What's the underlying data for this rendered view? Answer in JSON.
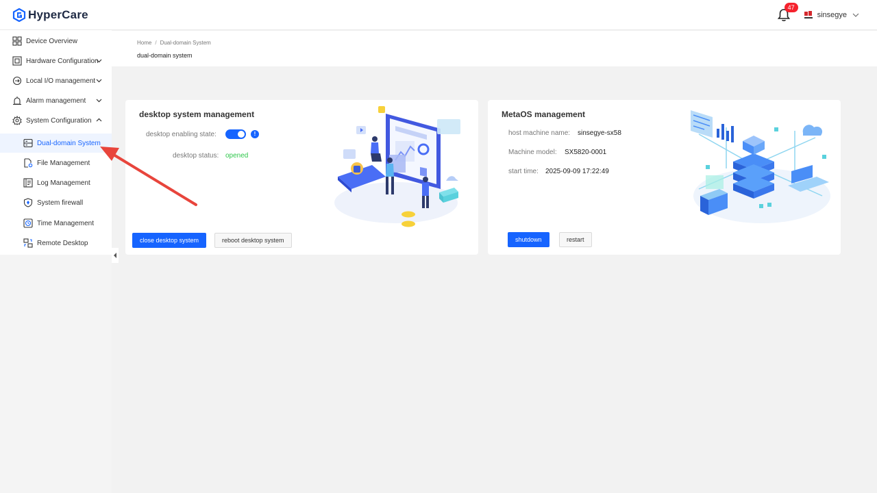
{
  "app": {
    "title": "HyperCare"
  },
  "header": {
    "notification_count": "47",
    "username": "sinsegye"
  },
  "sidebar": {
    "items": [
      {
        "label": "Device Overview"
      },
      {
        "label": "Hardware Configuration"
      },
      {
        "label": "Local I/O management"
      },
      {
        "label": "Alarm management"
      },
      {
        "label": "System Configuration"
      }
    ],
    "sub_items": [
      {
        "label": "Dual-domain System"
      },
      {
        "label": "File Management"
      },
      {
        "label": "Log Management"
      },
      {
        "label": "System firewall"
      },
      {
        "label": "Time Management"
      },
      {
        "label": "Remote Desktop"
      }
    ]
  },
  "breadcrumb": {
    "home": "Home",
    "sep": "/",
    "current": "Dual-domain System"
  },
  "page": {
    "title": "dual-domain system"
  },
  "desktop_card": {
    "title": "desktop system management",
    "enabling_label": "desktop enabling state:",
    "enabled": true,
    "status_label": "desktop status:",
    "status_value": "opened",
    "close_button": "close desktop system",
    "reboot_button": "reboot desktop system"
  },
  "metaos_card": {
    "title": "MetaOS management",
    "host_label": "host machine name:",
    "host_value": "sinsegye-sx58",
    "model_label": "Machine model:",
    "model_value": "SX5820-0001",
    "start_label": "start time:",
    "start_value": "2025-09-09 17:22:49",
    "shutdown_button": "shutdown",
    "restart_button": "restart"
  },
  "colors": {
    "primary": "#1664ff",
    "success": "#2ec74b",
    "badge": "#f5222d",
    "annotation": "#e8453c"
  }
}
